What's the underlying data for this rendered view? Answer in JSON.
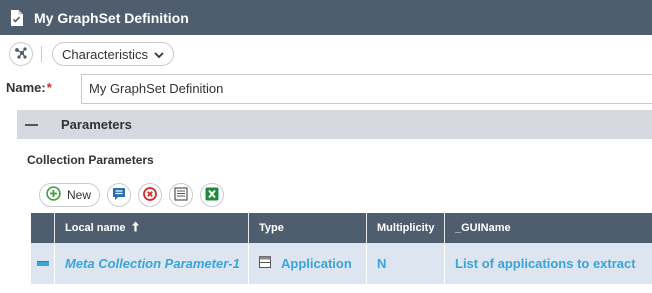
{
  "window": {
    "title": "My GraphSet Definition"
  },
  "toolbar": {
    "characteristics_label": "Characteristics"
  },
  "form": {
    "name_label": "Name:",
    "required_mark": "*",
    "name_value": "My GraphSet Definition"
  },
  "parameters_section": {
    "title": "Parameters",
    "collection_title": "Collection Parameters"
  },
  "actions": {
    "new_label": "New"
  },
  "grid": {
    "columns": [
      "Local name",
      "Type",
      "Multiplicity",
      "_GUIName"
    ],
    "rows": [
      {
        "local_name": "Meta Collection Parameter-1",
        "type": "Application",
        "multiplicity": "N",
        "gui_name": "List of applications to extract"
      }
    ]
  },
  "colors": {
    "titlebar": "#4f5e6e",
    "accent": "#3aa4d8",
    "row_bg": "#dde5f0",
    "section_bg": "#d6dae0"
  }
}
